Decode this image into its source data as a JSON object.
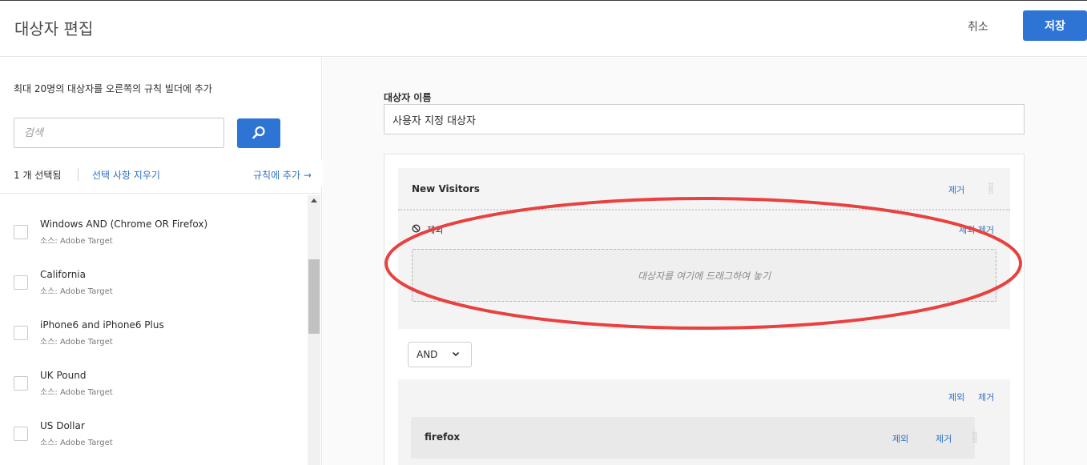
{
  "header": {
    "title": "대상자 편집",
    "cancel_label": "취소",
    "save_label": "저장"
  },
  "left_panel": {
    "intro": "최대 20명의 대상자를 오른쪽의 규칙 빌더에 추가",
    "search_placeholder": "검색",
    "selected_count": "1 개 선택됨",
    "clear_selection": "선택 사항 지우기",
    "add_to_rule": "규칙에 추가",
    "add_to_rule_arrow": "→",
    "audiences": [
      {
        "name": "Windows AND (Chrome OR Firefox)",
        "source": "소스: Adobe Target",
        "checked": false
      },
      {
        "name": "California",
        "source": "소스: Adobe Target",
        "checked": false
      },
      {
        "name": "iPhone6 and iPhone6 Plus",
        "source": "소스: Adobe Target",
        "checked": false
      },
      {
        "name": "UK Pound",
        "source": "소스: Adobe Target",
        "checked": false
      },
      {
        "name": "US Dollar",
        "source": "소스: Adobe Target",
        "checked": false
      }
    ]
  },
  "right_panel": {
    "name_label": "대상자 이름",
    "name_value": "사용자 지정 대상자",
    "group1": {
      "title": "New Visitors",
      "remove_label": "제거",
      "exclude_label": "제외",
      "remove_exclude_label": "제외 제거",
      "dropzone_text": "대상자를 여기에 드래그하여 놓기"
    },
    "operator": "AND",
    "group2": {
      "exclude_label": "제외",
      "remove_label": "제거",
      "item": {
        "title": "firefox",
        "exclude_label": "제외",
        "remove_label": "제거"
      }
    }
  },
  "colors": {
    "primary": "#2d74d4",
    "link": "#2d6fc4",
    "highlight_ellipse": "#e8413f"
  }
}
